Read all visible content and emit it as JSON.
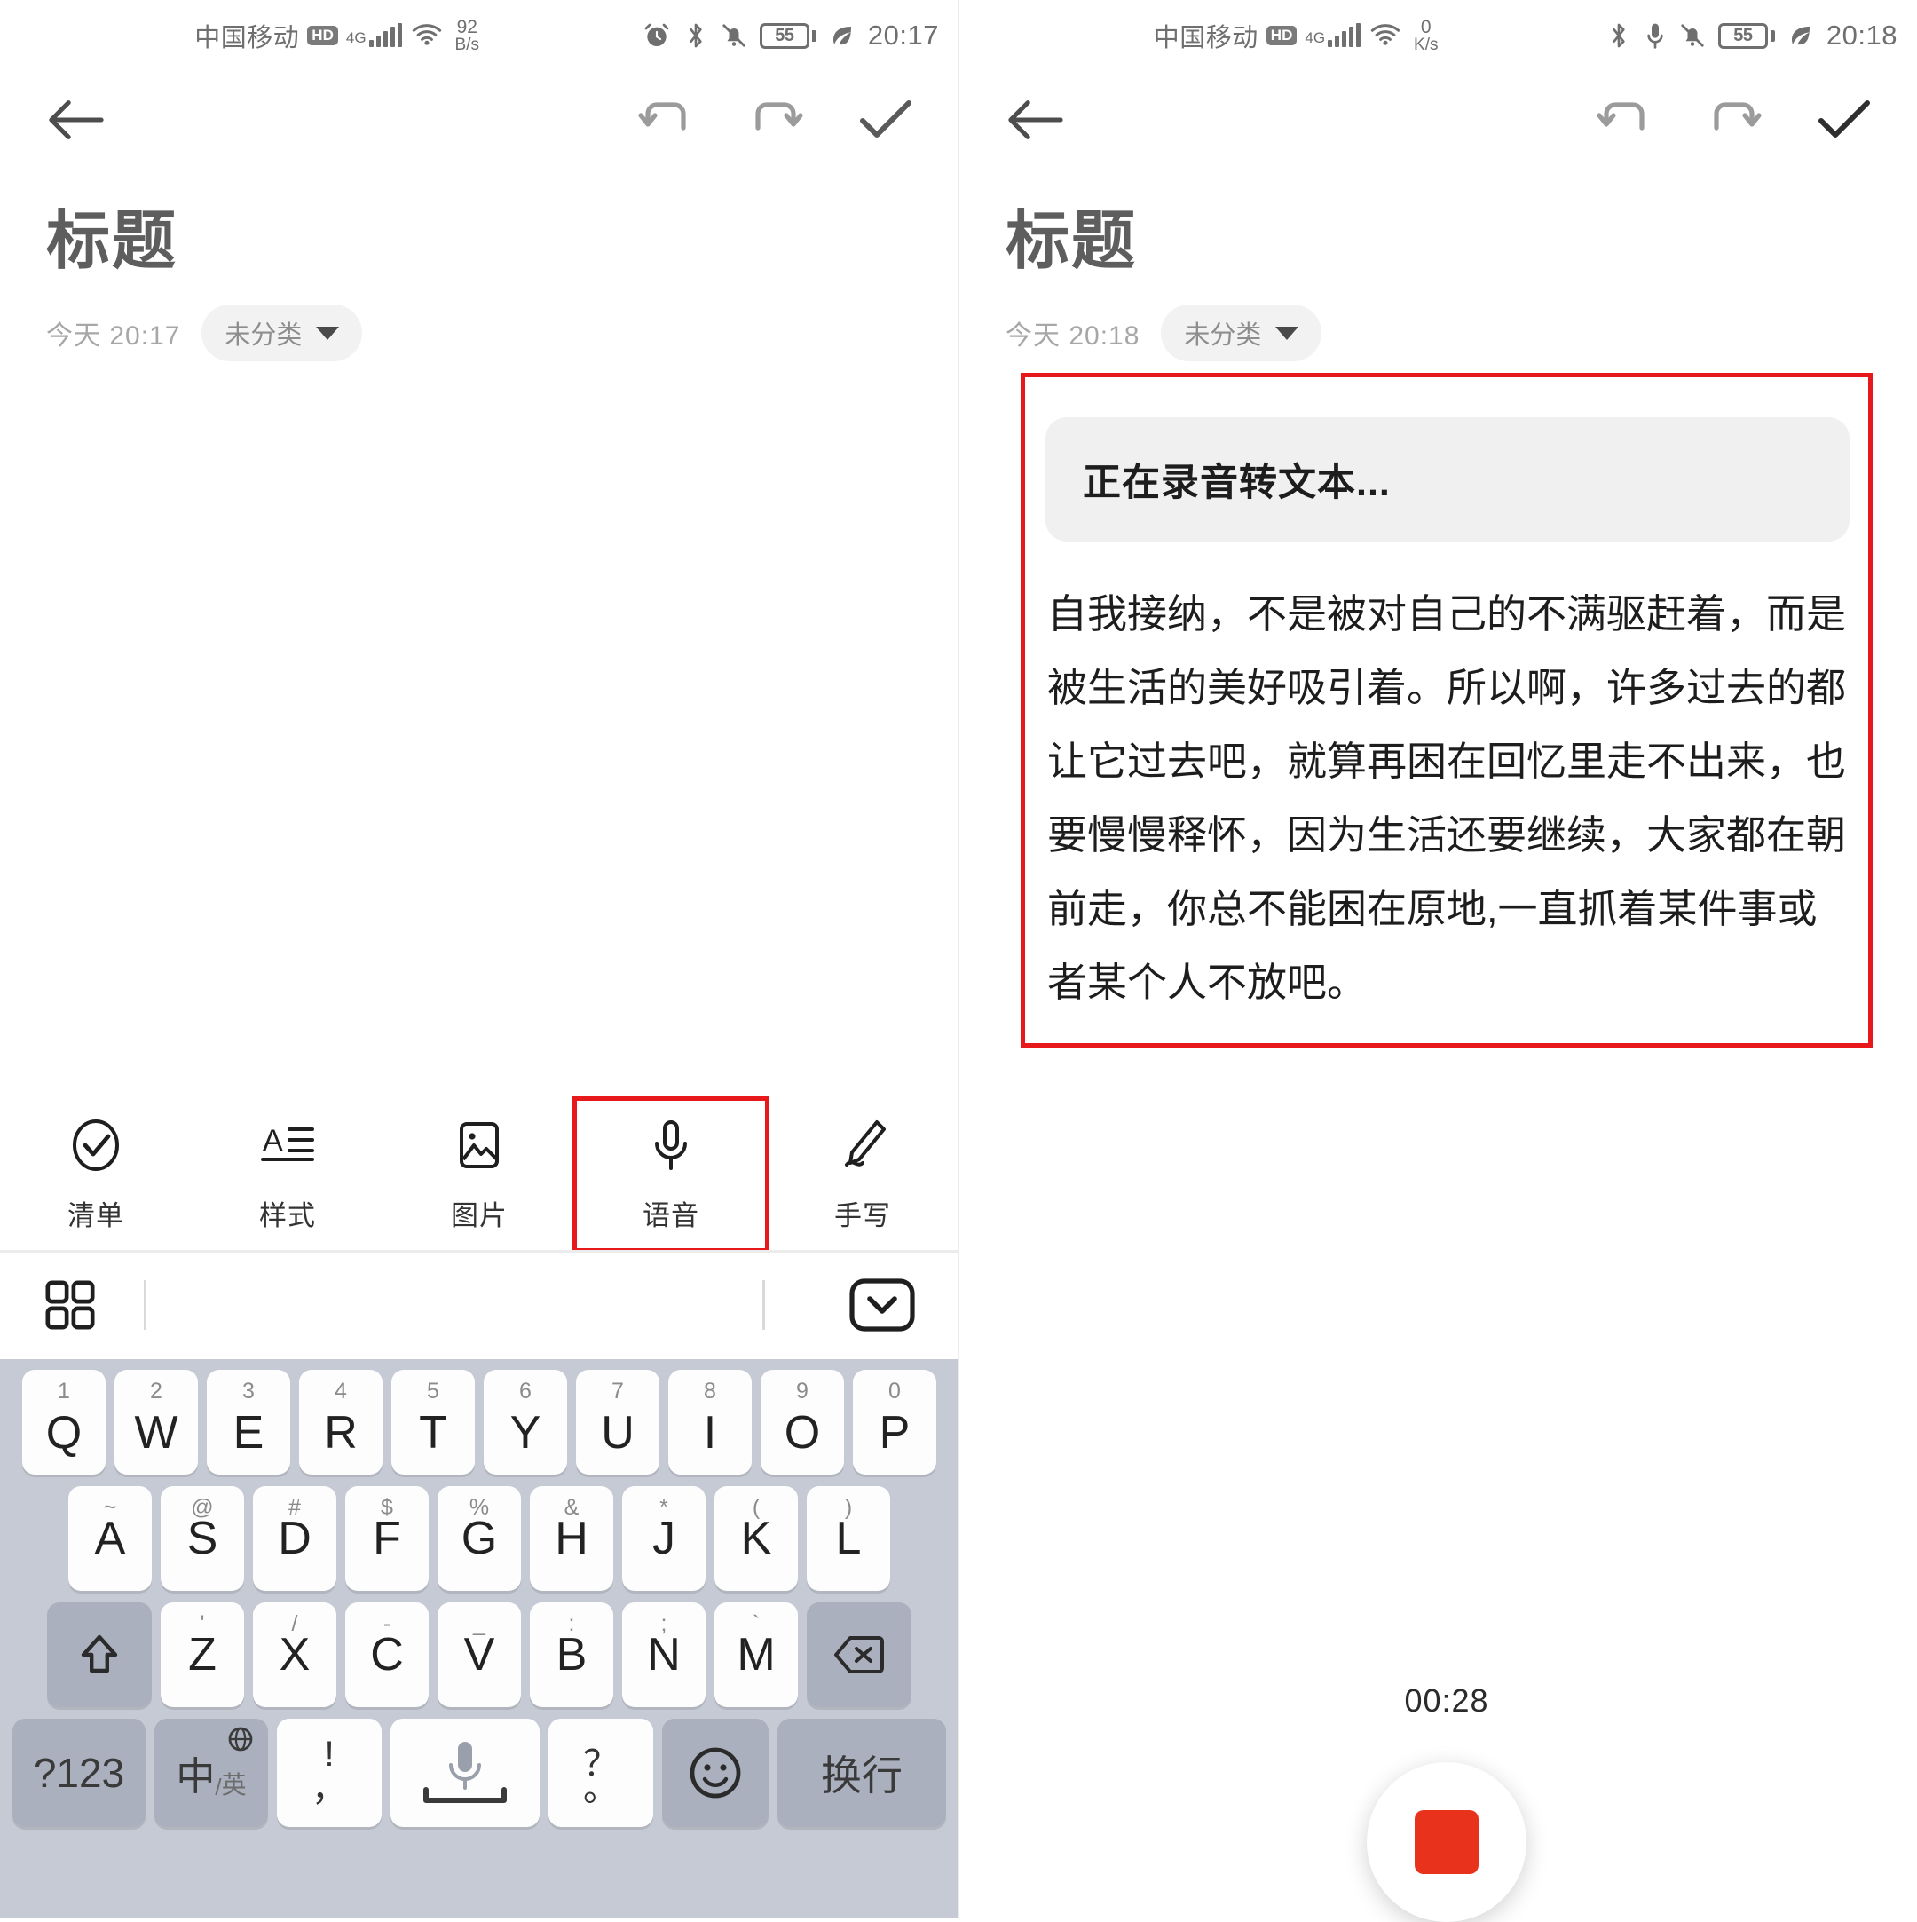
{
  "left_panel": {
    "status_bar": {
      "carrier": "中国移动",
      "hd_badge": "HD",
      "network_gen": "4G",
      "net_speed_value": "92",
      "net_speed_unit": "B/s",
      "battery_level": "55",
      "clock": "20:17",
      "icons": [
        "alarm-icon",
        "bluetooth-icon",
        "bell-muted-icon",
        "battery-icon",
        "leaf-icon"
      ]
    },
    "app_bar": {
      "back": "back-arrow-icon",
      "undo": "undo-icon",
      "redo": "redo-icon",
      "done": "check-icon"
    },
    "note": {
      "title": "标题",
      "timestamp": "今天 20:17",
      "category": "未分类"
    },
    "toolbar": {
      "items": [
        {
          "label": "清单",
          "icon": "check-circle-icon",
          "highlighted": false
        },
        {
          "label": "样式",
          "icon": "text-style-icon",
          "highlighted": false
        },
        {
          "label": "图片",
          "icon": "image-icon",
          "highlighted": false
        },
        {
          "label": "语音",
          "icon": "microphone-icon",
          "highlighted": true
        },
        {
          "label": "手写",
          "icon": "pen-icon",
          "highlighted": false
        }
      ]
    },
    "sub_bar": {
      "grid_icon": "grid-apps-icon",
      "collapse_icon": "keyboard-collapse-icon"
    },
    "keyboard": {
      "row1": [
        {
          "main": "Q",
          "sup": "1"
        },
        {
          "main": "W",
          "sup": "2"
        },
        {
          "main": "E",
          "sup": "3"
        },
        {
          "main": "R",
          "sup": "4"
        },
        {
          "main": "T",
          "sup": "5"
        },
        {
          "main": "Y",
          "sup": "6"
        },
        {
          "main": "U",
          "sup": "7"
        },
        {
          "main": "I",
          "sup": "8"
        },
        {
          "main": "O",
          "sup": "9"
        },
        {
          "main": "P",
          "sup": "0"
        }
      ],
      "row2": [
        {
          "main": "A",
          "sup": "~"
        },
        {
          "main": "S",
          "sup": "@"
        },
        {
          "main": "D",
          "sup": "#"
        },
        {
          "main": "F",
          "sup": "$"
        },
        {
          "main": "G",
          "sup": "%"
        },
        {
          "main": "H",
          "sup": "&"
        },
        {
          "main": "J",
          "sup": "*"
        },
        {
          "main": "K",
          "sup": "("
        },
        {
          "main": "L",
          "sup": ")"
        }
      ],
      "row3": [
        {
          "main": "Z",
          "sup": "'"
        },
        {
          "main": "X",
          "sup": "/"
        },
        {
          "main": "C",
          "sup": "-"
        },
        {
          "main": "V",
          "sup": "_"
        },
        {
          "main": "B",
          "sup": ":"
        },
        {
          "main": "N",
          "sup": ";"
        },
        {
          "main": "M",
          "sup": "`"
        }
      ],
      "shift_icon": "shift-up-icon",
      "backspace_icon": "backspace-icon",
      "num_key": "?123",
      "lang_key_cn": "中",
      "lang_key_en": "英",
      "punc_left_top": "!",
      "punc_left_bottom": "，",
      "punc_right_top": "？",
      "punc_right_bottom": "。",
      "space_icon": "space-mic-icon",
      "emoji_icon": "emoji-smile-icon",
      "enter_key": "换行"
    }
  },
  "right_panel": {
    "status_bar": {
      "carrier": "中国移动",
      "hd_badge": "HD",
      "network_gen": "4G",
      "net_speed_value": "0",
      "net_speed_unit": "K/s",
      "battery_level": "55",
      "clock": "20:18",
      "icons": [
        "bluetooth-icon",
        "microphone-icon",
        "bell-muted-icon",
        "battery-icon",
        "leaf-icon"
      ]
    },
    "app_bar": {
      "back": "back-arrow-icon",
      "undo": "undo-icon",
      "redo": "redo-icon",
      "done": "check-icon"
    },
    "note": {
      "title": "标题",
      "timestamp": "今天 20:18",
      "category": "未分类"
    },
    "transcription": {
      "status_hint": "正在录音转文本...",
      "text": "自我接纳，不是被对自己的不满驱赶着，而是被生活的美好吸引着。所以啊，许多过去的都让它过去吧，就算再困在回忆里走不出来，也要慢慢释怀，因为生活还要继续，大家都在朝前走，你总不能困在原地,一直抓着某件事或者某个人不放吧。"
    },
    "recorder": {
      "elapsed": "00:28",
      "stop_button": "stop-recording-button"
    }
  },
  "annotations": {
    "highlight_color": "#e8191b"
  }
}
